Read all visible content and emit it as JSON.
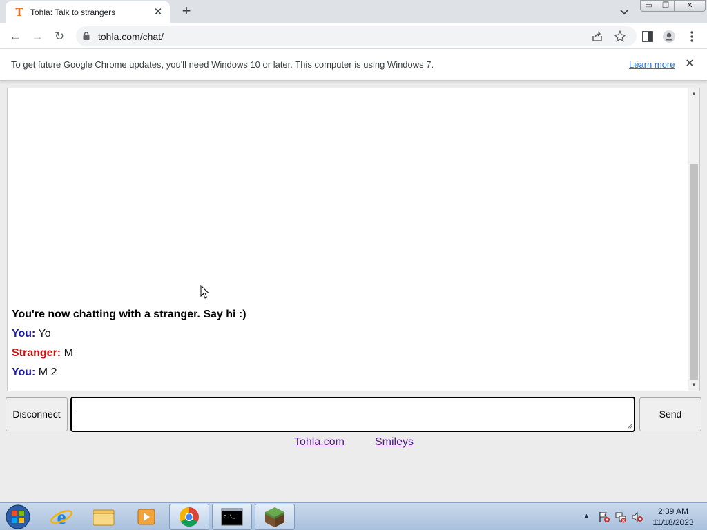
{
  "browser": {
    "tab": {
      "title": "Tohla: Talk to strangers",
      "favicon": "T",
      "close_symbol": "✕"
    },
    "new_tab_symbol": "+",
    "window_controls": {
      "minimize": "▭",
      "maximize": "❐",
      "close": "✕"
    },
    "address": {
      "url": "tohla.com/chat/"
    },
    "nav": {
      "back": "←",
      "forward": "→",
      "reload": "↻"
    },
    "infobar": {
      "message": "To get future Google Chrome updates, you'll need Windows 10 or later. This computer is using Windows 7.",
      "link": "Learn more",
      "close_symbol": "✕"
    }
  },
  "chat": {
    "status": "You're now chatting with a stranger. Say hi :)",
    "messages": [
      {
        "sender": "You:",
        "text": " Yo",
        "role": "you"
      },
      {
        "sender": "Stranger:",
        "text": " M",
        "role": "stranger"
      },
      {
        "sender": "You:",
        "text": " M 2",
        "role": "you"
      }
    ],
    "colors": {
      "you": "#1a1aa6",
      "stranger": "#cc1111"
    }
  },
  "controls": {
    "disconnect_label": "Disconnect",
    "send_label": "Send",
    "input_value": ""
  },
  "footer": {
    "link1": "Tohla.com",
    "link2": "Smileys"
  },
  "taskbar": {
    "time": "2:39 AM",
    "date": "11/18/2023",
    "apps": [
      "internet-explorer",
      "windows-explorer",
      "media-player",
      "chrome",
      "command-prompt",
      "minecraft"
    ]
  }
}
